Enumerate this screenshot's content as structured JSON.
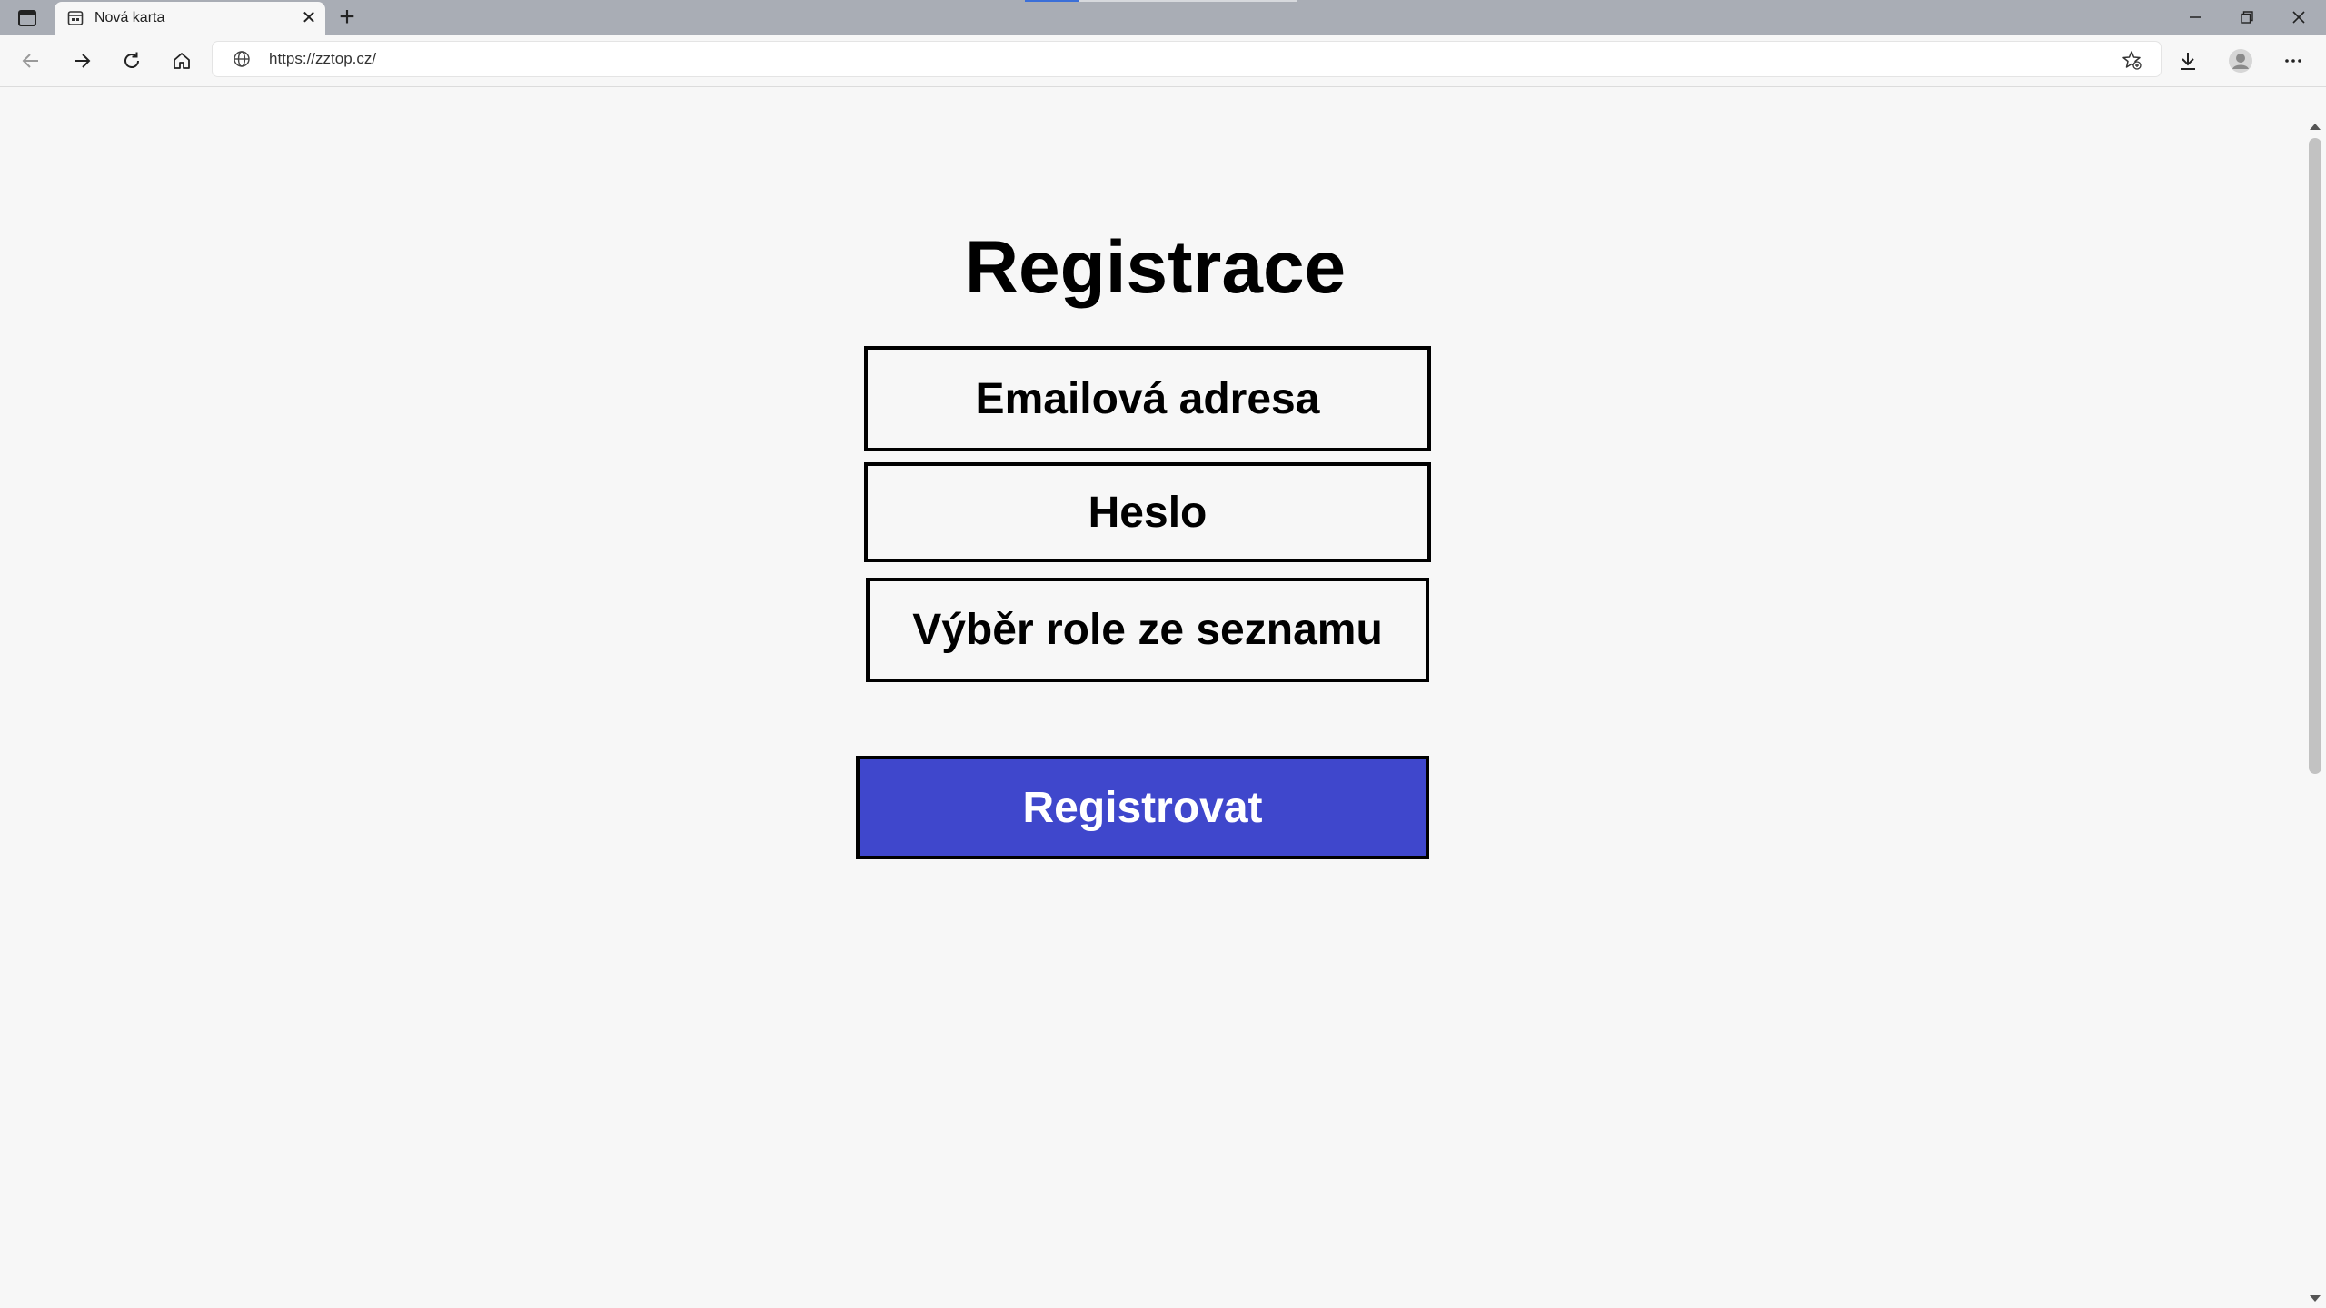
{
  "browser": {
    "tab": {
      "title": "Nová karta"
    },
    "address": {
      "url": "https://zztop.cz/"
    }
  },
  "page": {
    "title": "Registrace",
    "fields": {
      "email": "Emailová adresa",
      "password": "Heslo",
      "role": "Výběr role ze seznamu"
    },
    "submit_label": "Registrovat",
    "colors": {
      "submit_bg": "#3f47cc",
      "submit_text": "#ffffff",
      "page_bg": "#f7f7f7"
    }
  }
}
